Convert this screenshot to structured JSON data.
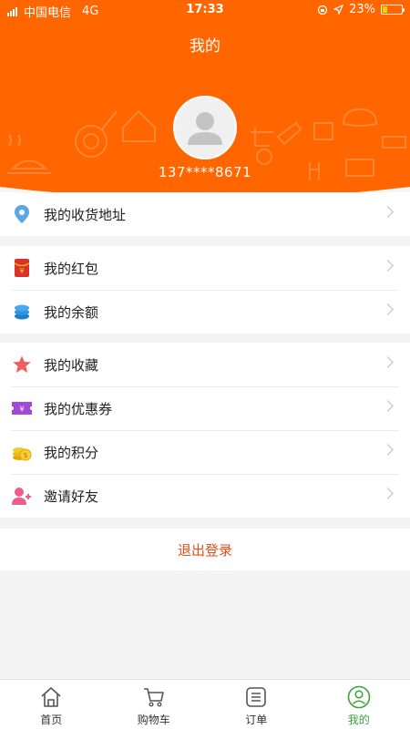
{
  "status_bar": {
    "carrier": "中国电信",
    "network": "4G",
    "time": "17:33",
    "battery": "23%",
    "battery_level": 0.23
  },
  "header": {
    "title": "我的",
    "phone": "137****8671",
    "bg_color": "#ff6600"
  },
  "sections": {
    "address": [
      {
        "label": "我的收货地址",
        "icon": "location-pin-icon"
      }
    ],
    "wallet": [
      {
        "label": "我的红包",
        "icon": "red-envelope-icon"
      },
      {
        "label": "我的余额",
        "icon": "balance-coins-icon"
      }
    ],
    "extras": [
      {
        "label": "我的收藏",
        "icon": "star-icon"
      },
      {
        "label": "我的优惠券",
        "icon": "coupon-icon"
      },
      {
        "label": "我的积分",
        "icon": "points-coin-icon"
      },
      {
        "label": "邀请好友",
        "icon": "invite-friend-icon"
      }
    ]
  },
  "logout_label": "退出登录",
  "tabbar": [
    {
      "label": "首页",
      "icon": "home-icon"
    },
    {
      "label": "购物车",
      "icon": "cart-icon"
    },
    {
      "label": "订单",
      "icon": "order-list-icon"
    },
    {
      "label": "我的",
      "icon": "profile-icon",
      "active": true
    }
  ],
  "colors": {
    "accent": "#ff6600",
    "logout": "#e0501e",
    "active_tab": "#3aa33a"
  }
}
